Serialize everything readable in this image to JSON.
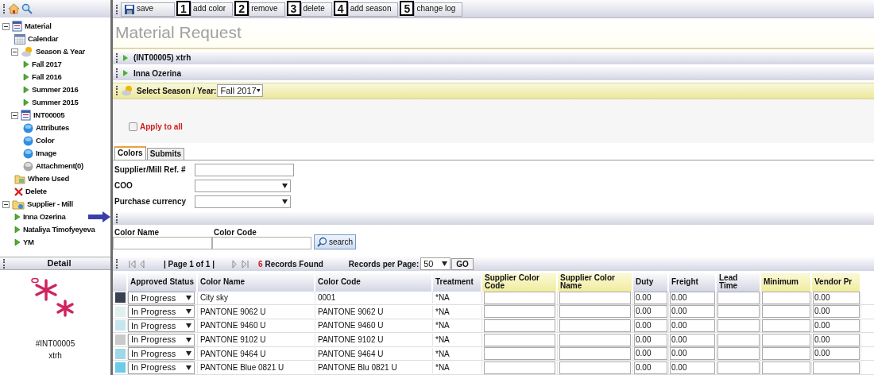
{
  "sidebar": {
    "tree": [
      {
        "label": "Material",
        "kind": "doc",
        "expanded": true,
        "children": [
          {
            "label": "Calendar",
            "kind": "calendar"
          },
          {
            "label": "Season & Year",
            "kind": "weather",
            "expanded": true,
            "children": [
              {
                "label": "Fall 2017",
                "kind": "play"
              },
              {
                "label": "Fall 2016",
                "kind": "play"
              },
              {
                "label": "Summer 2016",
                "kind": "play"
              },
              {
                "label": "Summer 2015",
                "kind": "play"
              }
            ]
          },
          {
            "label": "INT00005",
            "kind": "doc",
            "expanded": true,
            "children": [
              {
                "label": "Attributes",
                "kind": "dot-blue"
              },
              {
                "label": "Color",
                "kind": "dot-blue"
              },
              {
                "label": "Image",
                "kind": "dot-blue"
              },
              {
                "label": "Attachment(0)",
                "kind": "dot-gray"
              }
            ]
          },
          {
            "label": "Where Used",
            "kind": "where-used"
          },
          {
            "label": "Delete",
            "kind": "delete"
          }
        ]
      },
      {
        "label": "Supplier - Mill",
        "kind": "folder",
        "expanded": true,
        "children": [
          {
            "label": "Inna Ozerina",
            "kind": "play",
            "pointed": true
          },
          {
            "label": "Nataliya Timofyeyeva",
            "kind": "play"
          },
          {
            "label": "YM",
            "kind": "play"
          }
        ]
      }
    ],
    "detail": {
      "title": "Detail",
      "code": "#INT00005",
      "name": "xtrh"
    }
  },
  "toolbar": [
    {
      "label": "save",
      "kind": "save"
    },
    {
      "label": "add color",
      "marker": "1"
    },
    {
      "label": "remove",
      "marker": "2"
    },
    {
      "label": "delete",
      "marker": "3"
    },
    {
      "label": "add season",
      "marker": "4"
    },
    {
      "label": "change log",
      "marker": "5"
    }
  ],
  "title": "Material Request",
  "sections": [
    {
      "label": "(INT00005) xtrh"
    },
    {
      "label": "Inna Ozerina"
    }
  ],
  "season": {
    "label": "Select Season / Year:",
    "value": "Fall 2017"
  },
  "apply_to_all": {
    "label": "Apply to all",
    "checked": false
  },
  "tabs": [
    {
      "label": "Colors",
      "selected": true
    },
    {
      "label": "Submits",
      "selected": false
    }
  ],
  "form": [
    {
      "label": "Supplier/Mill Ref. #",
      "kind": "text"
    },
    {
      "label": "COO",
      "kind": "select"
    },
    {
      "label": "Purchase currency",
      "kind": "select"
    }
  ],
  "search": {
    "fields": [
      "Color Name",
      "Color Code"
    ],
    "button": "search"
  },
  "pager": {
    "page": "| Page 1 of 1 |",
    "count": "6",
    "found": "Records Found",
    "per_page_label": "Records per Page:",
    "per_page": "50",
    "go": "GO"
  },
  "table": {
    "columns": [
      {
        "label": "Approved Status",
        "highlight": false
      },
      {
        "label": "Color Name",
        "highlight": false
      },
      {
        "label": "Color Code",
        "highlight": false
      },
      {
        "label": "Treatment",
        "highlight": false
      },
      {
        "label": "Supplier Color Code",
        "highlight": true
      },
      {
        "label": "Supplier Color Name",
        "highlight": true
      },
      {
        "label": "Duty",
        "highlight": false
      },
      {
        "label": "Freight",
        "highlight": false
      },
      {
        "label": "Lead Time",
        "highlight": false
      },
      {
        "label": "Minimum",
        "highlight": true
      },
      {
        "label": "Vendor Pr",
        "highlight": true
      }
    ],
    "rows": [
      {
        "color": "#3a4150",
        "status": "In Progress",
        "color_name": "City sky",
        "color_code": "0001",
        "treatment": "*NA",
        "duty": "0.00",
        "freight": "0.00",
        "vendor_price": "0.00"
      },
      {
        "color": "#dff0ef",
        "status": "In Progress",
        "color_name": "PANTONE 9062 U",
        "color_code": "PANTONE 9062 U",
        "treatment": "*NA",
        "duty": "0.00",
        "freight": "0.00",
        "vendor_price": "0.00"
      },
      {
        "color": "#c6e6ee",
        "status": "In Progress",
        "color_name": "PANTONE 9460 U",
        "color_code": "PANTONE 9460 U",
        "treatment": "*NA",
        "duty": "0.00",
        "freight": "0.00",
        "vendor_price": "0.00"
      },
      {
        "color": "#c9cbc8",
        "status": "In Progress",
        "color_name": "PANTONE 9102 U",
        "color_code": "PANTONE 9102 U",
        "treatment": "*NA",
        "duty": "0.00",
        "freight": "0.00",
        "vendor_price": "0.00"
      },
      {
        "color": "#9fd8e8",
        "status": "In Progress",
        "color_name": "PANTONE 9464 U",
        "color_code": "PANTONE 9464 U",
        "treatment": "*NA",
        "duty": "0.00",
        "freight": "0.00",
        "vendor_price": "0.00"
      },
      {
        "color": "#6ccbe6",
        "status": "In Progress",
        "color_name": "PANTONE Blue 0821 U",
        "color_code": "PANTONE Blu 0821 U",
        "treatment": "*NA",
        "duty": "0.00",
        "freight": "0.00"
      }
    ]
  }
}
